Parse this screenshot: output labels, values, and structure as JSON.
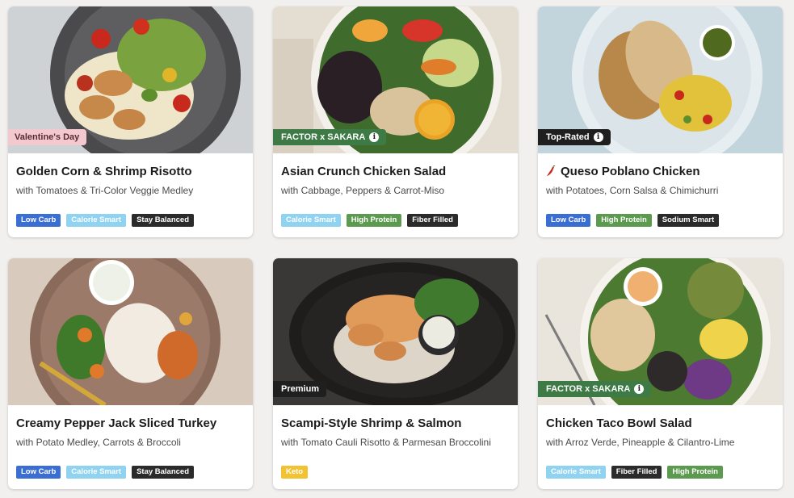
{
  "meals": [
    {
      "badge": "Valentine's Day",
      "title": "Golden Corn & Shrimp Risotto",
      "subtitle": "with Tomatoes & Tri-Color Veggie Medley",
      "tags": [
        "Low Carb",
        "Calorie Smart",
        "Stay Balanced"
      ]
    },
    {
      "badge": "FACTOR x SAKARA",
      "title": "Asian Crunch Chicken Salad",
      "subtitle": "with Cabbage, Peppers & Carrot-Miso",
      "tags": [
        "Calorie Smart",
        "High Protein",
        "Fiber Filled"
      ]
    },
    {
      "badge": "Top-Rated",
      "title": "Queso Poblano Chicken",
      "subtitle": "with Potatoes, Corn Salsa & Chimichurri",
      "tags": [
        "Low Carb",
        "High Protein",
        "Sodium Smart"
      ]
    },
    {
      "title": "Creamy Pepper Jack Sliced Turkey",
      "subtitle": "with Potato Medley, Carrots & Broccoli",
      "tags": [
        "Low Carb",
        "Calorie Smart",
        "Stay Balanced"
      ]
    },
    {
      "badge": "Premium",
      "title": "Scampi-Style Shrimp & Salmon",
      "subtitle": "with Tomato Cauli Risotto & Parmesan Broccolini",
      "tags": [
        "Keto"
      ]
    },
    {
      "badge": "FACTOR x SAKARA",
      "title": "Chicken Taco Bowl Salad",
      "subtitle": "with Arroz Verde, Pineapple & Cilantro-Lime",
      "tags": [
        "Calorie Smart",
        "Fiber Filled",
        "High Protein"
      ]
    }
  ],
  "colors": {
    "low_carb": "#3b6ed3",
    "calorie_smart": "#8fd3f0",
    "stay_balanced": "#2b2b2b",
    "high_protein": "#5c9b4f",
    "keto": "#f2c233",
    "badge_green": "#3d7a45",
    "badge_dark": "#1f1f1f",
    "badge_pink": "#f3c9cf"
  },
  "icons": {
    "info": "info-icon",
    "spicy": "chili-pepper-icon"
  }
}
